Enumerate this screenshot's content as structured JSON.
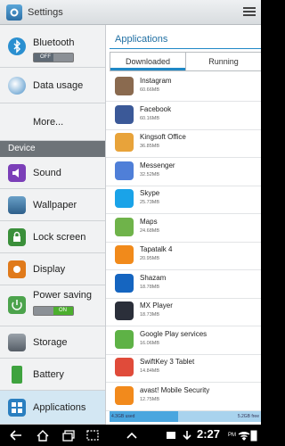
{
  "header": {
    "title": "Settings",
    "icon": "settings-icon",
    "menu_icon": "overflow-menu-icon"
  },
  "left_pane": {
    "items": [
      {
        "label": "Bluetooth",
        "icon": "bluetooth-icon",
        "toggle": "OFF"
      },
      {
        "label": "Data usage",
        "icon": "data-usage-icon"
      },
      {
        "label": "More...",
        "icon": ""
      }
    ],
    "section": "Device",
    "device_items": [
      {
        "label": "Sound",
        "icon": "sound-icon"
      },
      {
        "label": "Wallpaper",
        "icon": "wallpaper-icon"
      },
      {
        "label": "Lock screen",
        "icon": "lock-screen-icon"
      },
      {
        "label": "Display",
        "icon": "display-icon"
      },
      {
        "label": "Power saving",
        "icon": "power-saving-icon",
        "toggle": "ON"
      },
      {
        "label": "Storage",
        "icon": "storage-icon"
      },
      {
        "label": "Battery",
        "icon": "battery-icon"
      },
      {
        "label": "Applications",
        "icon": "applications-icon",
        "selected": true
      }
    ]
  },
  "right_pane": {
    "title": "Applications",
    "tabs": [
      {
        "label": "Downloaded",
        "active": true
      },
      {
        "label": "Running",
        "active": false
      }
    ],
    "apps": [
      {
        "name": "Instagram",
        "size": "60.66MB",
        "icon": "instagram-icon",
        "color": "#8a6a4f"
      },
      {
        "name": "Facebook",
        "size": "60.16MB",
        "icon": "facebook-icon",
        "color": "#3b5998"
      },
      {
        "name": "Kingsoft Office",
        "size": "36.85MB",
        "icon": "kingsoft-office-icon",
        "color": "#e8a33a"
      },
      {
        "name": "Messenger",
        "size": "32.52MB",
        "icon": "messenger-icon",
        "color": "#4f7fd8"
      },
      {
        "name": "Skype",
        "size": "25.73MB",
        "icon": "skype-icon",
        "color": "#1aa3e8"
      },
      {
        "name": "Maps",
        "size": "24.68MB",
        "icon": "maps-icon",
        "color": "#6fb34a"
      },
      {
        "name": "Tapatalk 4",
        "size": "20.95MB",
        "icon": "tapatalk-icon",
        "color": "#f18a1b"
      },
      {
        "name": "Shazam",
        "size": "18.78MB",
        "icon": "shazam-icon",
        "color": "#1565c0"
      },
      {
        "name": "MX Player",
        "size": "18.73MB",
        "icon": "mx-player-icon",
        "color": "#2b2f3a"
      },
      {
        "name": "Google Play services",
        "size": "16.06MB",
        "icon": "google-play-services-icon",
        "color": "#5eb246"
      },
      {
        "name": "SwiftKey 3 Tablet",
        "size": "14.84MB",
        "icon": "swiftkey-icon",
        "color": "#e04b3a"
      },
      {
        "name": "avast! Mobile Security",
        "size": "12.75MB",
        "icon": "avast-icon",
        "color": "#f28a1c"
      }
    ],
    "storage": {
      "used": "4.3GB used",
      "free": "5.2GB free",
      "used_fraction": 0.45
    }
  },
  "system_bar": {
    "time": "2:27",
    "ampm": "PM"
  }
}
